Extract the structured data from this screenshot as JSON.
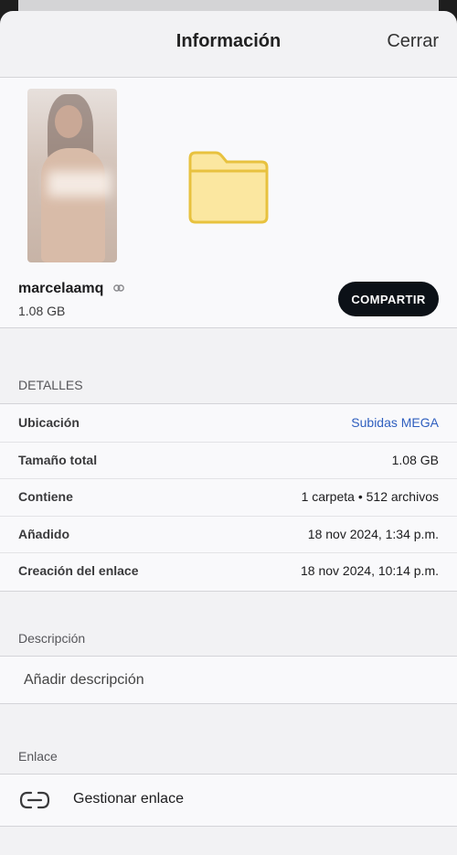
{
  "header": {
    "title": "Información",
    "close_label": "Cerrar"
  },
  "item": {
    "name": "marcelaamq",
    "size": "1.08 GB",
    "share_label": "COMPARTIR",
    "folder_color": "#fbe7a0"
  },
  "details": {
    "section_label": "DETALLES",
    "rows": [
      {
        "key": "Ubicación",
        "value": "Subidas MEGA"
      },
      {
        "key": "Tamaño total",
        "value": "1.08 GB"
      },
      {
        "key": "Contiene",
        "value": "1 carpeta • 512 archivos"
      },
      {
        "key": "Añadido",
        "value": "18 nov 2024, 1:34 p.m."
      },
      {
        "key": "Creación del enlace",
        "value": "18 nov 2024, 10:14 p.m."
      }
    ]
  },
  "description": {
    "section_label": "Descripción",
    "placeholder": "Añadir descripción"
  },
  "link": {
    "section_label": "Enlace",
    "manage_label": "Gestionar enlace"
  },
  "colors": {
    "accent_link": "#2f5fbf",
    "share_button_bg": "#0c1117"
  }
}
